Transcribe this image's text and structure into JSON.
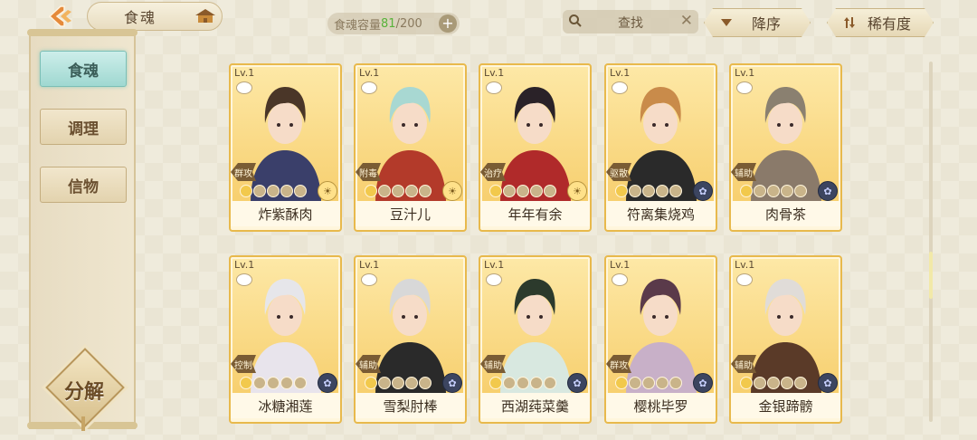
{
  "header": {
    "title": "食魂",
    "capacity_label": "食魂容量",
    "capacity_current": "81",
    "capacity_total": "/200",
    "capacity_add": "+",
    "search_text": "查找",
    "search_clear": "✕",
    "sort_order_label": "降序",
    "sort_rarity_label": "稀有度"
  },
  "sidebar": {
    "tabs": [
      {
        "label": "食魂",
        "active": true
      },
      {
        "label": "调理",
        "active": false
      },
      {
        "label": "信物",
        "active": false
      }
    ],
    "decompose_label": "分解"
  },
  "cards": [
    {
      "level": "Lv.1",
      "role": "群攻",
      "name": "炸紫酥肉",
      "element": "sun",
      "stars": 5
    },
    {
      "level": "Lv.1",
      "role": "附毒",
      "name": "豆汁儿",
      "element": "sun",
      "stars": 5
    },
    {
      "level": "Lv.1",
      "role": "治疗",
      "name": "年年有余",
      "element": "sun",
      "stars": 5
    },
    {
      "level": "Lv.1",
      "role": "驱散",
      "name": "符离集烧鸡",
      "element": "flower",
      "stars": 5
    },
    {
      "level": "Lv.1",
      "role": "辅助",
      "name": "肉骨茶",
      "element": "flower",
      "stars": 5
    },
    {
      "level": "Lv.1",
      "role": "控制",
      "name": "冰糖湘莲",
      "element": "flower",
      "stars": 5
    },
    {
      "level": "Lv.1",
      "role": "辅助",
      "name": "雪梨肘棒",
      "element": "flower",
      "stars": 5
    },
    {
      "level": "Lv.1",
      "role": "辅助",
      "name": "西湖莼菜羹",
      "element": "flower",
      "stars": 5
    },
    {
      "level": "Lv.1",
      "role": "群攻",
      "name": "樱桃毕罗",
      "element": "flower",
      "stars": 5
    },
    {
      "level": "Lv.1",
      "role": "辅助",
      "name": "金银蹄髈",
      "element": "flower",
      "stars": 5
    }
  ],
  "colors": {
    "card_border": "#e8b94c",
    "tab_active": "#9fd8d1",
    "capacity_current": "#58b23a"
  }
}
